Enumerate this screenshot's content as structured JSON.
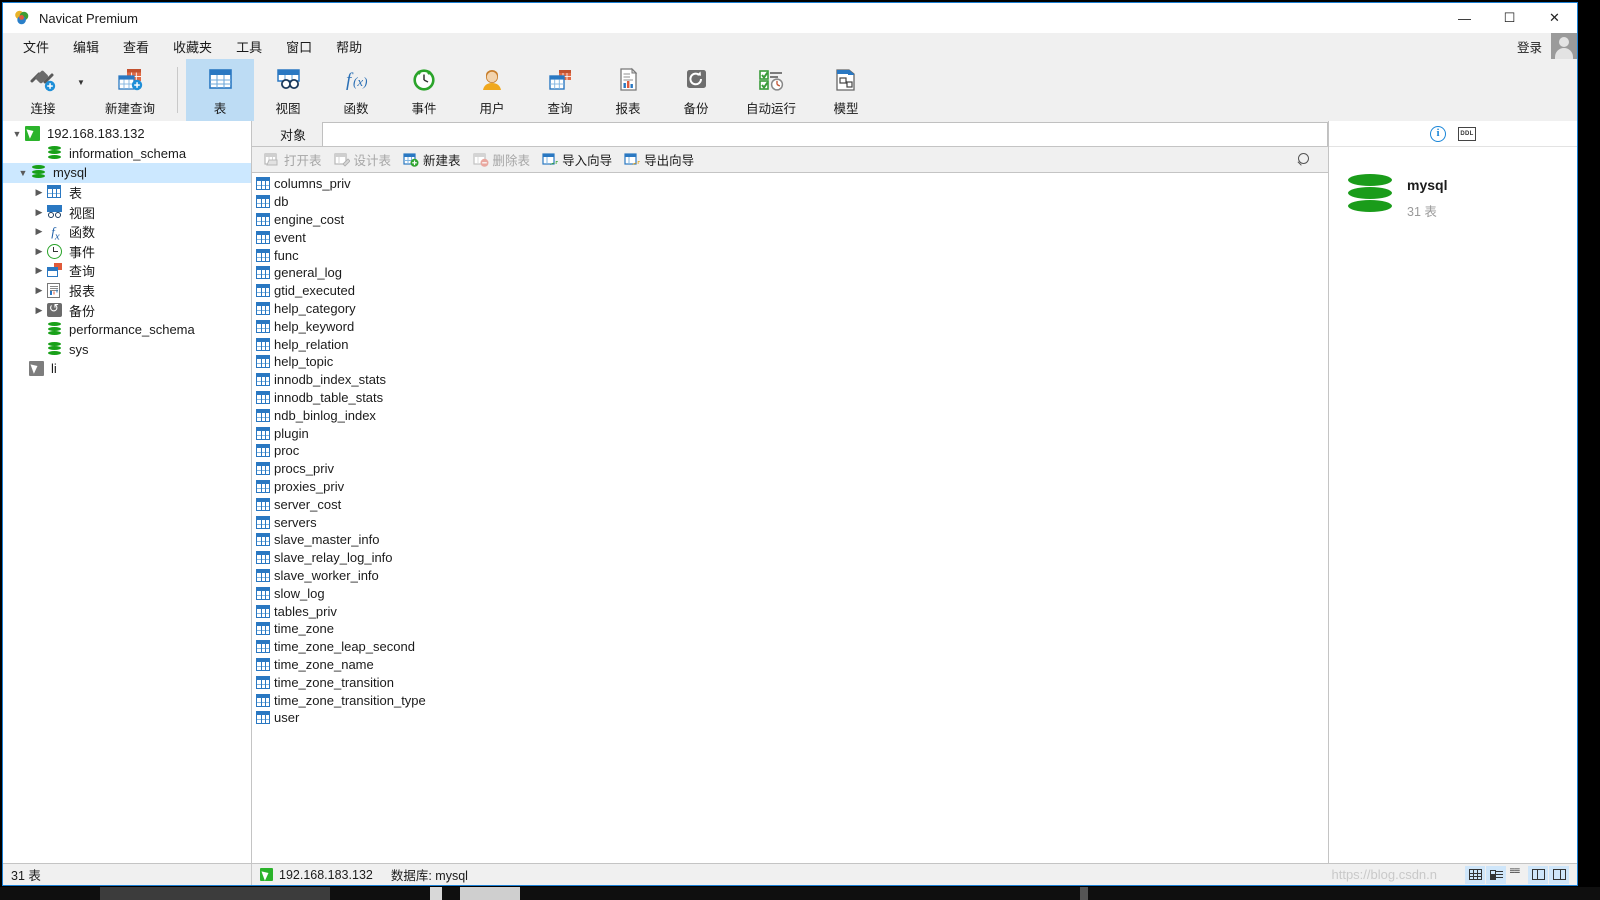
{
  "window": {
    "title": "Navicat Premium",
    "logo_icon": "navicat-logo-icon",
    "minimize": "—",
    "maximize": "☐",
    "close": "✕"
  },
  "menubar": {
    "items": [
      {
        "label": "文件",
        "name": "menu-file"
      },
      {
        "label": "编辑",
        "name": "menu-edit"
      },
      {
        "label": "查看",
        "name": "menu-view"
      },
      {
        "label": "收藏夹",
        "name": "menu-favorites"
      },
      {
        "label": "工具",
        "name": "menu-tools"
      },
      {
        "label": "窗口",
        "name": "menu-window"
      },
      {
        "label": "帮助",
        "name": "menu-help"
      }
    ],
    "login_label": "登录"
  },
  "ribbon": {
    "items": [
      {
        "label": "连接",
        "icon": "connection-plug-icon",
        "selected": false
      },
      {
        "label": "新建查询",
        "icon": "new-query-icon",
        "selected": false
      },
      {
        "label": "表",
        "icon": "table-icon",
        "selected": true
      },
      {
        "label": "视图",
        "icon": "view-icon",
        "selected": false
      },
      {
        "label": "函数",
        "icon": "function-fx-icon",
        "selected": false
      },
      {
        "label": "事件",
        "icon": "event-clock-icon",
        "selected": false
      },
      {
        "label": "用户",
        "icon": "user-icon",
        "selected": false
      },
      {
        "label": "查询",
        "icon": "query-icon",
        "selected": false
      },
      {
        "label": "报表",
        "icon": "report-icon",
        "selected": false
      },
      {
        "label": "备份",
        "icon": "backup-icon",
        "selected": false
      },
      {
        "label": "自动运行",
        "icon": "automation-icon",
        "selected": false
      },
      {
        "label": "模型",
        "icon": "model-icon",
        "selected": false
      }
    ]
  },
  "sidebar": {
    "nodes": [
      {
        "label": "192.168.183.132",
        "icon": "connection-icon",
        "indent": 0,
        "arrow": "expanded",
        "selected": false
      },
      {
        "label": "information_schema",
        "icon": "database-icon",
        "indent": 1,
        "arrow": "none",
        "selected": false
      },
      {
        "label": "mysql",
        "icon": "database-icon",
        "indent": 1,
        "arrow": "expanded",
        "selected": true
      },
      {
        "label": "表",
        "icon": "table-icon",
        "indent": 2,
        "arrow": "collapsed",
        "selected": false
      },
      {
        "label": "视图",
        "icon": "view-icon",
        "indent": 2,
        "arrow": "collapsed",
        "selected": false
      },
      {
        "label": "函数",
        "icon": "function-fx-icon",
        "indent": 2,
        "arrow": "collapsed",
        "selected": false
      },
      {
        "label": "事件",
        "icon": "event-clock-icon",
        "indent": 2,
        "arrow": "collapsed",
        "selected": false
      },
      {
        "label": "查询",
        "icon": "query-icon",
        "indent": 2,
        "arrow": "collapsed",
        "selected": false
      },
      {
        "label": "报表",
        "icon": "report-icon",
        "indent": 2,
        "arrow": "collapsed",
        "selected": false
      },
      {
        "label": "备份",
        "icon": "backup-icon",
        "indent": 2,
        "arrow": "collapsed",
        "selected": false
      },
      {
        "label": "performance_schema",
        "icon": "database-icon",
        "indent": 1,
        "arrow": "none",
        "selected": false
      },
      {
        "label": "sys",
        "icon": "database-icon",
        "indent": 1,
        "arrow": "none",
        "selected": false
      },
      {
        "label": "li",
        "icon": "connection-icon-disconnected",
        "indent": 0,
        "arrow": "none",
        "selected": false
      }
    ]
  },
  "main": {
    "tab_label": "对象",
    "toolbar": [
      {
        "label": "打开表",
        "name": "open-table-button",
        "icon": "open-table-icon",
        "disabled": true
      },
      {
        "label": "设计表",
        "name": "design-table-button",
        "icon": "design-table-icon",
        "disabled": true
      },
      {
        "label": "新建表",
        "name": "new-table-button",
        "icon": "new-table-icon",
        "disabled": false
      },
      {
        "label": "删除表",
        "name": "delete-table-button",
        "icon": "delete-table-icon",
        "disabled": true
      },
      {
        "label": "导入向导",
        "name": "import-wizard-button",
        "icon": "import-wizard-icon",
        "disabled": false
      },
      {
        "label": "导出向导",
        "name": "export-wizard-button",
        "icon": "export-wizard-icon",
        "disabled": false
      }
    ],
    "search_icon": "search-icon",
    "tables": [
      "columns_priv",
      "db",
      "engine_cost",
      "event",
      "func",
      "general_log",
      "gtid_executed",
      "help_category",
      "help_keyword",
      "help_relation",
      "help_topic",
      "innodb_index_stats",
      "innodb_table_stats",
      "ndb_binlog_index",
      "plugin",
      "proc",
      "procs_priv",
      "proxies_priv",
      "server_cost",
      "servers",
      "slave_master_info",
      "slave_relay_log_info",
      "slave_worker_info",
      "slow_log",
      "tables_priv",
      "time_zone",
      "time_zone_leap_second",
      "time_zone_name",
      "time_zone_transition",
      "time_zone_transition_type",
      "user"
    ]
  },
  "right_panel": {
    "info_icon": "info-icon",
    "ddl_icon": "ddl-icon",
    "ddl_label": "DDL",
    "db_icon": "database-cylinder-icon",
    "title": "mysql",
    "subtitle": "31 表"
  },
  "statusbar": {
    "left": "31 表",
    "host_icon": "connection-icon",
    "host": "192.168.183.132",
    "database": "数据库: mysql",
    "watermark": "https://blog.csdn.n",
    "view_buttons": [
      {
        "name": "grid-view-button",
        "icon": "grid-view-icon",
        "active": true
      },
      {
        "name": "form-view-button",
        "icon": "form-view-icon",
        "active": true
      },
      {
        "name": "blob-view-button",
        "icon": "blob-view-icon",
        "active": false
      },
      {
        "name": "split-vertical-button",
        "icon": "split-vertical-icon",
        "active": true
      },
      {
        "name": "split-horizontal-button",
        "icon": "split-horizontal-icon",
        "active": true
      }
    ]
  },
  "colors": {
    "accent": "#1a7fd4",
    "selection": "#cce8ff",
    "ribbon_selected": "#bddcf4",
    "chrome": "#f0f0f0",
    "db_green": "#18a018",
    "table_blue": "#2a78c2"
  }
}
